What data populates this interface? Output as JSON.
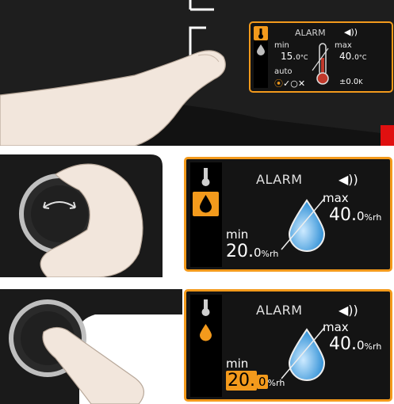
{
  "top_display": {
    "title": "ALARM",
    "min_label": "min",
    "min_value": "15.",
    "min_decimal": "0",
    "min_unit": "°C",
    "max_label": "max",
    "max_value": "40.",
    "max_decimal": "0",
    "max_unit": "°C",
    "auto_label": "auto",
    "offset_value": "±0.0",
    "offset_unit": "K",
    "auto_options": [
      "⦿",
      "✓",
      "○",
      "✕"
    ]
  },
  "mid_display": {
    "title": "ALARM",
    "max_label": "max",
    "max_value": "40.",
    "max_decimal": "0",
    "max_unit": "%rh",
    "min_label": "min",
    "min_value": "20.",
    "min_decimal": "0",
    "min_unit": "%rh"
  },
  "bottom_display": {
    "title": "ALARM",
    "max_label": "max",
    "max_value": "40.",
    "max_decimal": "0",
    "max_unit": "%rh",
    "min_label": "min",
    "min_value": "20.",
    "min_decimal": "0",
    "min_unit": "%rh"
  },
  "colors": {
    "accent": "#f39a1c",
    "screen_bg": "#141414",
    "drop_blue": "#2e8fd6"
  }
}
